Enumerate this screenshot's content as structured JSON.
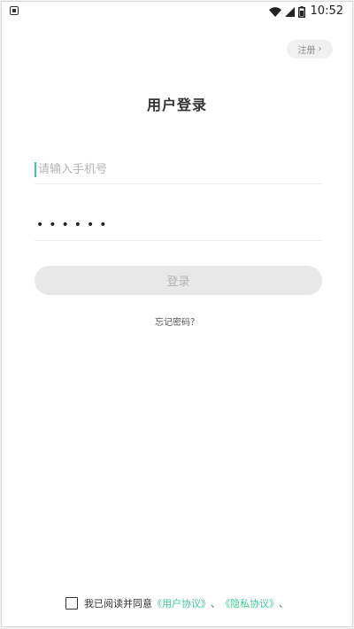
{
  "status_bar": {
    "time": "10:52",
    "icons": [
      "notification-icon",
      "wifi-icon",
      "signal-icon",
      "battery-icon"
    ]
  },
  "header": {
    "register_label": "注册",
    "register_chevron": "›"
  },
  "title": "用户登录",
  "form": {
    "phone_placeholder": "请输入手机号",
    "password_masked": "••••••",
    "login_label": "登录",
    "forgot_label": "忘记密码？"
  },
  "agreement": {
    "prefix": "我已阅读并同意",
    "user_agreement": "《用户协议》",
    "separator": "、",
    "privacy_agreement": "《隐私协议》",
    "suffix": "、"
  },
  "colors": {
    "accent": "#3ecb95",
    "disabled_button": "#e8e8e8",
    "disabled_text": "#b3b3b3",
    "placeholder": "#b5b5b5"
  }
}
